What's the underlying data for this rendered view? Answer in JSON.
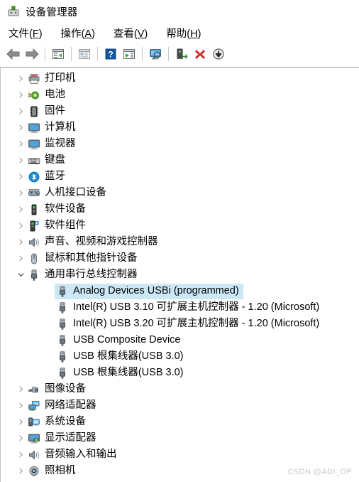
{
  "window": {
    "title": "设备管理器",
    "title_icon": "device-manager-icon"
  },
  "menubar": {
    "items": [
      {
        "name": "file",
        "label_pre": "文件(",
        "accel": "F",
        "label_post": ")"
      },
      {
        "name": "action",
        "label_pre": "操作(",
        "accel": "A",
        "label_post": ")"
      },
      {
        "name": "view",
        "label_pre": "查看(",
        "accel": "V",
        "label_post": ")"
      },
      {
        "name": "help",
        "label_pre": "帮助(",
        "accel": "H",
        "label_post": ")"
      }
    ]
  },
  "toolbar": {
    "buttons": [
      {
        "name": "back-button",
        "icon": "arrow-left-icon"
      },
      {
        "name": "forward-button",
        "icon": "arrow-right-icon"
      },
      {
        "name": "show-hide-tree-button",
        "icon": "window-tree-icon"
      },
      {
        "name": "properties-button",
        "icon": "properties-icon"
      },
      {
        "name": "help-button",
        "icon": "question-mark-icon"
      },
      {
        "name": "scan-changes-button",
        "icon": "window-play-icon"
      },
      {
        "name": "scan-hardware-button",
        "icon": "monitor-search-icon"
      },
      {
        "name": "update-driver-button",
        "icon": "update-driver-icon"
      },
      {
        "name": "uninstall-device-button",
        "icon": "red-x-icon"
      },
      {
        "name": "disable-device-button",
        "icon": "arrow-down-circle-icon"
      }
    ]
  },
  "tree": {
    "nodes": [
      {
        "label": "打印机",
        "icon": "printer-icon",
        "level": 1,
        "state": "collapsed",
        "selected": false
      },
      {
        "label": "电池",
        "icon": "battery-icon",
        "level": 1,
        "state": "collapsed",
        "selected": false
      },
      {
        "label": "固件",
        "icon": "firmware-icon",
        "level": 1,
        "state": "collapsed",
        "selected": false
      },
      {
        "label": "计算机",
        "icon": "computer-icon",
        "level": 1,
        "state": "collapsed",
        "selected": false
      },
      {
        "label": "监视器",
        "icon": "monitor-icon",
        "level": 1,
        "state": "collapsed",
        "selected": false
      },
      {
        "label": "键盘",
        "icon": "keyboard-icon",
        "level": 1,
        "state": "collapsed",
        "selected": false
      },
      {
        "label": "蓝牙",
        "icon": "bluetooth-icon",
        "level": 1,
        "state": "collapsed",
        "selected": false
      },
      {
        "label": "人机接口设备",
        "icon": "hid-icon",
        "level": 1,
        "state": "collapsed",
        "selected": false
      },
      {
        "label": "软件设备",
        "icon": "software-device-icon",
        "level": 1,
        "state": "collapsed",
        "selected": false
      },
      {
        "label": "软件组件",
        "icon": "software-component-icon",
        "level": 1,
        "state": "collapsed",
        "selected": false
      },
      {
        "label": "声音、视频和游戏控制器",
        "icon": "speaker-icon",
        "level": 1,
        "state": "collapsed",
        "selected": false
      },
      {
        "label": "鼠标和其他指针设备",
        "icon": "mouse-icon",
        "level": 1,
        "state": "collapsed",
        "selected": false
      },
      {
        "label": "通用串行总线控制器",
        "icon": "usb-icon",
        "level": 1,
        "state": "expanded",
        "selected": false
      },
      {
        "label": "Analog Devices USBi (programmed)",
        "icon": "usb-icon",
        "level": 2,
        "state": "leaf",
        "selected": true
      },
      {
        "label": "Intel(R) USB 3.10 可扩展主机控制器 - 1.20 (Microsoft)",
        "icon": "usb-icon",
        "level": 2,
        "state": "leaf",
        "selected": false
      },
      {
        "label": "Intel(R) USB 3.20 可扩展主机控制器 - 1.20 (Microsoft)",
        "icon": "usb-icon",
        "level": 2,
        "state": "leaf",
        "selected": false
      },
      {
        "label": "USB Composite Device",
        "icon": "usb-icon",
        "level": 2,
        "state": "leaf",
        "selected": false
      },
      {
        "label": "USB 根集线器(USB 3.0)",
        "icon": "usb-icon",
        "level": 2,
        "state": "leaf",
        "selected": false
      },
      {
        "label": "USB 根集线器(USB 3.0)",
        "icon": "usb-icon",
        "level": 2,
        "state": "leaf",
        "selected": false
      },
      {
        "label": "图像设备",
        "icon": "imaging-icon",
        "level": 1,
        "state": "collapsed",
        "selected": false
      },
      {
        "label": "网络适配器",
        "icon": "network-icon",
        "level": 1,
        "state": "collapsed",
        "selected": false
      },
      {
        "label": "系统设备",
        "icon": "system-device-icon",
        "level": 1,
        "state": "collapsed",
        "selected": false
      },
      {
        "label": "显示适配器",
        "icon": "display-adapter-icon",
        "level": 1,
        "state": "collapsed",
        "selected": false
      },
      {
        "label": "音频输入和输出",
        "icon": "audio-io-icon",
        "level": 1,
        "state": "collapsed",
        "selected": false
      },
      {
        "label": "照相机",
        "icon": "camera-icon",
        "level": 1,
        "state": "collapsed",
        "selected": false
      }
    ]
  },
  "watermark": {
    "text": "CSDN @ADI_OP"
  },
  "colors": {
    "selection": "#cce8f7",
    "accent_blue": "#1e90d2",
    "danger_red": "#d42a2a",
    "green": "#5aa832"
  }
}
